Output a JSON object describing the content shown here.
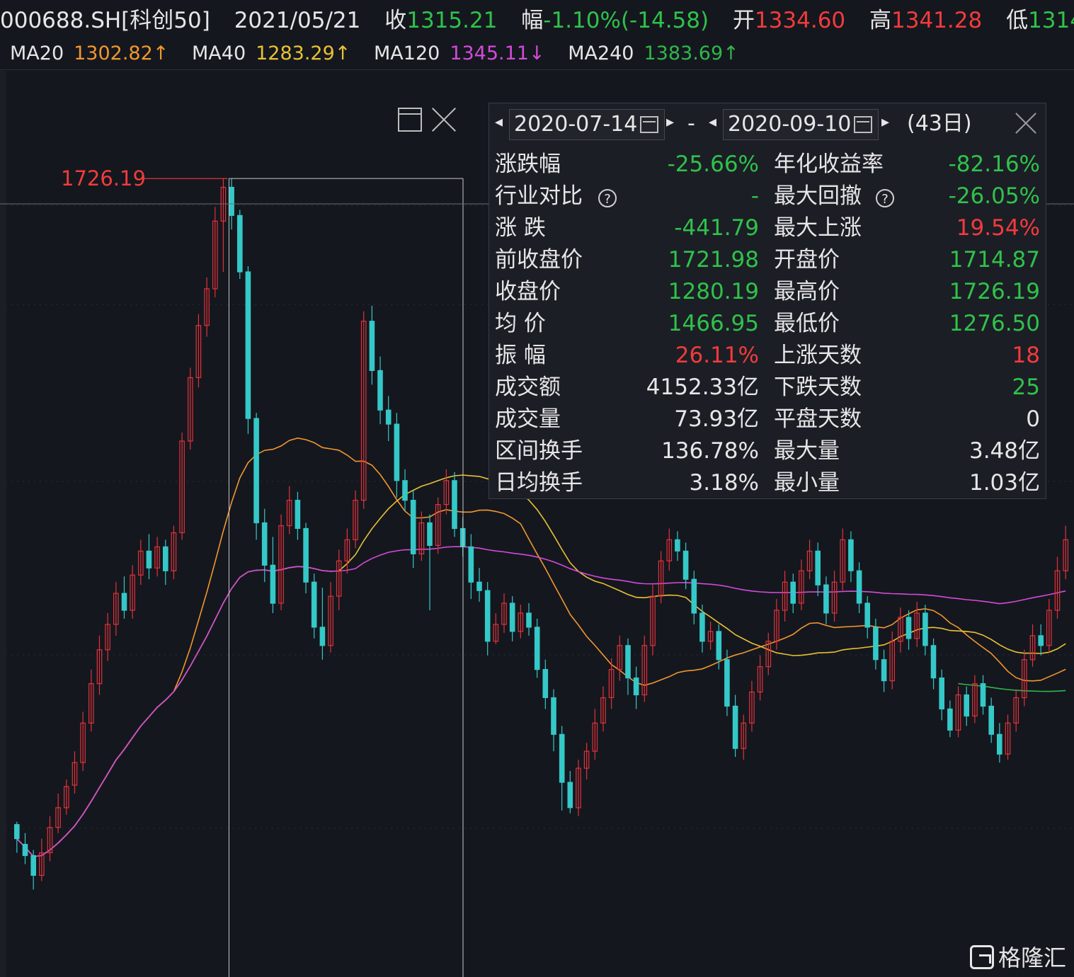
{
  "header": {
    "code": "000688.SH[科创50]",
    "date": "2021/05/21",
    "close_label": "收",
    "close_value": "1315.21",
    "change_label": "幅",
    "change_value": "-1.10%(-14.58)",
    "open_label": "开",
    "open_value": "1334.60",
    "high_label": "高",
    "high_value": "1341.28",
    "low_label": "低",
    "low_value": "1314"
  },
  "ma_bar": [
    {
      "name": "MA20",
      "value": "1302.82↑",
      "color": "#f0972f"
    },
    {
      "name": "MA40",
      "value": "1283.29↑",
      "color": "#e8c233"
    },
    {
      "name": "MA120",
      "value": "1345.11↓",
      "color": "#d24bd8"
    },
    {
      "name": "MA240",
      "value": "1383.69↑",
      "color": "#2fb74a"
    }
  ],
  "stats_panel": {
    "start_date": "2020-07-14",
    "dash": "-",
    "end_date": "2020-09-10",
    "days": "(43日)",
    "rows": [
      {
        "l1": "涨跌幅",
        "v1": "-25.66%",
        "c1": "#2fc24a",
        "l2": "年化收益率",
        "v2": "-82.16%",
        "c2": "#2fc24a"
      },
      {
        "l1": "行业对比",
        "h1": "?",
        "v1": "-",
        "c1": "#2fc24a",
        "l2": "最大回撤",
        "h2": "?",
        "v2": "-26.05%",
        "c2": "#2fc24a"
      },
      {
        "l1": "涨  跌",
        "v1": "-441.79",
        "c1": "#2fc24a",
        "l2": "最大上涨",
        "v2": "19.54%",
        "c2": "#f23b3b"
      },
      {
        "l1": "前收盘价",
        "v1": "1721.98",
        "c1": "#2fc24a",
        "l2": "开盘价",
        "v2": "1714.87",
        "c2": "#2fc24a"
      },
      {
        "l1": "收盘价",
        "v1": "1280.19",
        "c1": "#2fc24a",
        "l2": "最高价",
        "v2": "1726.19",
        "c2": "#2fc24a"
      },
      {
        "l1": "均  价",
        "v1": "1466.95",
        "c1": "#2fc24a",
        "l2": "最低价",
        "v2": "1276.50",
        "c2": "#2fc24a"
      },
      {
        "l1": "振  幅",
        "v1": "26.11%",
        "c1": "#f23b3b",
        "l2": "上涨天数",
        "v2": "18",
        "c2": "#f23b3b"
      },
      {
        "l1": "成交额",
        "v1": "4152.33亿",
        "c1": "#e6e6e6",
        "l2": "下跌天数",
        "v2": "25",
        "c2": "#2fc24a"
      },
      {
        "l1": "成交量",
        "v1": "73.93亿",
        "c1": "#e6e6e6",
        "l2": "平盘天数",
        "v2": "0",
        "c2": "#e6e6e6"
      },
      {
        "l1": "区间换手",
        "v1": "136.78%",
        "c1": "#e6e6e6",
        "l2": "最大量",
        "v2": "3.48亿",
        "c2": "#e6e6e6"
      },
      {
        "l1": "日均换手",
        "v1": "3.18%",
        "c1": "#e6e6e6",
        "l2": "最小量",
        "v2": "1.03亿",
        "c2": "#e6e6e6"
      }
    ]
  },
  "watermark": "格隆汇",
  "chart_data": {
    "type": "candlestick",
    "ylim": [
      1180,
      1780
    ],
    "peak_label": "1726.19",
    "colors": {
      "up": "#e0323b",
      "down": "#35c8c8",
      "ma20": "#f0972f",
      "ma40": "#e8c233",
      "ma120": "#d24bd8",
      "ma240": "#2fb74a"
    },
    "candles": [
      [
        1268,
        1258,
        1270,
        1248
      ],
      [
        1254,
        1246,
        1262,
        1240
      ],
      [
        1246,
        1232,
        1250,
        1222
      ],
      [
        1232,
        1248,
        1258,
        1228
      ],
      [
        1248,
        1266,
        1274,
        1242
      ],
      [
        1266,
        1280,
        1290,
        1262
      ],
      [
        1280,
        1295,
        1300,
        1275
      ],
      [
        1296,
        1312,
        1320,
        1290
      ],
      [
        1312,
        1340,
        1348,
        1306
      ],
      [
        1340,
        1368,
        1378,
        1334
      ],
      [
        1368,
        1392,
        1402,
        1360
      ],
      [
        1392,
        1410,
        1418,
        1384
      ],
      [
        1410,
        1432,
        1440,
        1402
      ],
      [
        1432,
        1420,
        1444,
        1414
      ],
      [
        1420,
        1445,
        1452,
        1414
      ],
      [
        1445,
        1462,
        1470,
        1438
      ],
      [
        1462,
        1450,
        1474,
        1442
      ],
      [
        1450,
        1465,
        1472,
        1444
      ],
      [
        1465,
        1448,
        1470,
        1438
      ],
      [
        1448,
        1475,
        1480,
        1442
      ],
      [
        1475,
        1540,
        1546,
        1470
      ],
      [
        1540,
        1585,
        1592,
        1534
      ],
      [
        1585,
        1622,
        1630,
        1578
      ],
      [
        1622,
        1648,
        1656,
        1614
      ],
      [
        1648,
        1696,
        1706,
        1642
      ],
      [
        1696,
        1720,
        1726,
        1660
      ],
      [
        1720,
        1700,
        1726,
        1690
      ],
      [
        1700,
        1660,
        1704,
        1655
      ],
      [
        1660,
        1556,
        1664,
        1545
      ],
      [
        1556,
        1482,
        1560,
        1470
      ],
      [
        1482,
        1452,
        1492,
        1440
      ],
      [
        1452,
        1425,
        1472,
        1418
      ],
      [
        1425,
        1480,
        1488,
        1420
      ],
      [
        1480,
        1498,
        1508,
        1474
      ],
      [
        1498,
        1478,
        1504,
        1470
      ],
      [
        1478,
        1440,
        1482,
        1432
      ],
      [
        1440,
        1408,
        1446,
        1400
      ],
      [
        1408,
        1395,
        1436,
        1385
      ],
      [
        1395,
        1430,
        1440,
        1390
      ],
      [
        1430,
        1455,
        1463,
        1420
      ],
      [
        1455,
        1470,
        1478,
        1446
      ],
      [
        1470,
        1498,
        1505,
        1464
      ],
      [
        1498,
        1625,
        1632,
        1492
      ],
      [
        1625,
        1590,
        1636,
        1580
      ],
      [
        1590,
        1562,
        1600,
        1552
      ],
      [
        1562,
        1552,
        1572,
        1540
      ],
      [
        1552,
        1512,
        1560,
        1500
      ],
      [
        1512,
        1498,
        1520,
        1490
      ],
      [
        1498,
        1460,
        1505,
        1450
      ],
      [
        1460,
        1482,
        1490,
        1455
      ],
      [
        1482,
        1466,
        1488,
        1420
      ],
      [
        1466,
        1495,
        1500,
        1460
      ],
      [
        1495,
        1512,
        1520,
        1488
      ],
      [
        1512,
        1478,
        1518,
        1472
      ],
      [
        1478,
        1465,
        1486,
        1458
      ],
      [
        1465,
        1440,
        1474,
        1428
      ],
      [
        1440,
        1434,
        1450,
        1426
      ],
      [
        1434,
        1398,
        1440,
        1388
      ],
      [
        1398,
        1410,
        1418,
        1396
      ],
      [
        1410,
        1425,
        1432,
        1404
      ],
      [
        1425,
        1405,
        1430,
        1398
      ],
      [
        1405,
        1418,
        1424,
        1400
      ],
      [
        1418,
        1408,
        1425,
        1402
      ],
      [
        1408,
        1378,
        1414,
        1372
      ],
      [
        1378,
        1358,
        1385,
        1350
      ],
      [
        1358,
        1332,
        1364,
        1320
      ],
      [
        1332,
        1298,
        1338,
        1278
      ],
      [
        1298,
        1280,
        1306,
        1276
      ],
      [
        1280,
        1308,
        1314,
        1274
      ],
      [
        1308,
        1320,
        1326,
        1300
      ],
      [
        1320,
        1340,
        1350,
        1314
      ],
      [
        1340,
        1358,
        1366,
        1334
      ],
      [
        1358,
        1378,
        1386,
        1350
      ],
      [
        1378,
        1395,
        1402,
        1370
      ],
      [
        1395,
        1372,
        1400,
        1360
      ],
      [
        1372,
        1360,
        1380,
        1350
      ],
      [
        1360,
        1395,
        1402,
        1355
      ],
      [
        1395,
        1430,
        1438,
        1388
      ],
      [
        1430,
        1455,
        1462,
        1425
      ],
      [
        1455,
        1470,
        1478,
        1448
      ],
      [
        1470,
        1462,
        1476,
        1455
      ],
      [
        1462,
        1442,
        1468,
        1435
      ],
      [
        1442,
        1418,
        1448,
        1410
      ],
      [
        1418,
        1398,
        1424,
        1390
      ],
      [
        1398,
        1405,
        1412,
        1392
      ],
      [
        1405,
        1385,
        1410,
        1378
      ],
      [
        1385,
        1352,
        1392,
        1345
      ],
      [
        1352,
        1322,
        1360,
        1316
      ],
      [
        1322,
        1340,
        1346,
        1314
      ],
      [
        1340,
        1362,
        1370,
        1334
      ],
      [
        1362,
        1380,
        1388,
        1356
      ],
      [
        1380,
        1398,
        1404,
        1374
      ],
      [
        1398,
        1420,
        1428,
        1392
      ],
      [
        1420,
        1440,
        1448,
        1412
      ],
      [
        1440,
        1425,
        1446,
        1418
      ],
      [
        1425,
        1448,
        1456,
        1420
      ],
      [
        1448,
        1462,
        1470,
        1442
      ],
      [
        1462,
        1438,
        1468,
        1430
      ],
      [
        1438,
        1418,
        1444,
        1410
      ],
      [
        1418,
        1440,
        1448,
        1412
      ],
      [
        1440,
        1470,
        1478,
        1434
      ],
      [
        1470,
        1448,
        1476,
        1440
      ],
      [
        1448,
        1425,
        1454,
        1418
      ],
      [
        1425,
        1408,
        1430,
        1400
      ],
      [
        1408,
        1385,
        1414,
        1378
      ],
      [
        1385,
        1370,
        1392,
        1362
      ],
      [
        1370,
        1398,
        1405,
        1364
      ],
      [
        1398,
        1415,
        1422,
        1390
      ],
      [
        1415,
        1400,
        1420,
        1392
      ],
      [
        1400,
        1418,
        1426,
        1394
      ],
      [
        1418,
        1395,
        1424,
        1388
      ],
      [
        1395,
        1372,
        1400,
        1364
      ],
      [
        1372,
        1350,
        1378,
        1342
      ],
      [
        1350,
        1335,
        1356,
        1330
      ],
      [
        1335,
        1360,
        1366,
        1330
      ],
      [
        1360,
        1345,
        1366,
        1338
      ],
      [
        1345,
        1368,
        1374,
        1340
      ],
      [
        1368,
        1352,
        1374,
        1346
      ],
      [
        1352,
        1332,
        1358,
        1326
      ],
      [
        1332,
        1318,
        1340,
        1312
      ],
      [
        1318,
        1340,
        1346,
        1314
      ],
      [
        1340,
        1358,
        1364,
        1334
      ],
      [
        1358,
        1385,
        1392,
        1352
      ],
      [
        1385,
        1402,
        1410,
        1380
      ],
      [
        1402,
        1395,
        1410,
        1388
      ],
      [
        1395,
        1420,
        1428,
        1390
      ],
      [
        1420,
        1448,
        1458,
        1414
      ],
      [
        1448,
        1470,
        1480,
        1442
      ]
    ]
  }
}
